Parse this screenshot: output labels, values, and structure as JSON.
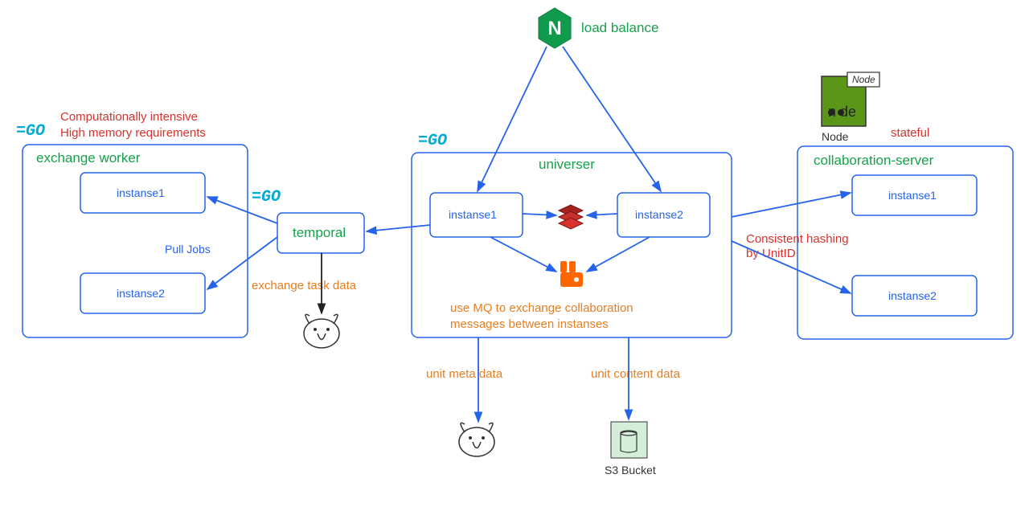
{
  "diagram": {
    "nginx": {
      "label": "load balance"
    },
    "exchangeWorker": {
      "title": "exchange worker",
      "note1": "Computationally intensive",
      "note2": "High memory requirements",
      "instance1": "instanse1",
      "instance2": "instanse2",
      "pullJobs": "Pull Jobs"
    },
    "temporal": {
      "title": "temporal",
      "note": "exchange task data"
    },
    "universer": {
      "title": "universer",
      "instance1": "instanse1",
      "instance2": "instanse2",
      "mqNote1": "use MQ to exchange collaboration",
      "mqNote2": "messages between instanses",
      "unitMeta": "unit meta data",
      "unitContent": "unit content data"
    },
    "collab": {
      "title": "collaboration-server",
      "note": "stateful",
      "instance1": "instanse1",
      "instance2": "instanse2",
      "hashNote1": "Consistent hashing",
      "hashNote2": "by UnitID"
    },
    "s3": {
      "label": "S3 Bucket"
    },
    "nodeLabel": "Node"
  }
}
